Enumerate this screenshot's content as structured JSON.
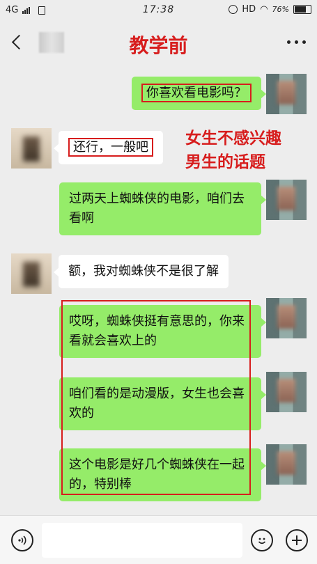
{
  "status_bar": {
    "network": "4G",
    "time": "17:38",
    "hd": "HD",
    "battery_text": "76%",
    "battery_level": 0.76
  },
  "header": {
    "title": "教学前"
  },
  "annotation": {
    "line1": "女生不感兴趣",
    "line2": "男生的话题"
  },
  "messages": [
    {
      "side": "mine",
      "text": "你喜欢看电影吗？",
      "highlighted": true
    },
    {
      "side": "other",
      "text": "还行，一般吧",
      "highlighted": true
    },
    {
      "side": "mine",
      "text": "过两天上蜘蛛侠的电影，咱们去看啊"
    },
    {
      "side": "other",
      "text": "额，我对蜘蛛侠不是很了解"
    },
    {
      "side": "mine",
      "text": "哎呀，蜘蛛侠挺有意思的，你来看就会喜欢上的"
    },
    {
      "side": "mine",
      "text": "咱们看的是动漫版，女生也会喜欢的"
    },
    {
      "side": "mine",
      "text": "这个电影是好几个蜘蛛侠在一起的，特别棒"
    }
  ],
  "colors": {
    "accent_red": "#d71d1d",
    "bubble_mine": "#95ec69",
    "bubble_other": "#ffffff",
    "background": "#ededed"
  },
  "icons": {
    "back": "chevron-left-icon",
    "more": "more-dots-icon",
    "voice": "voice-icon",
    "emoji": "emoji-icon",
    "plus": "plus-icon"
  }
}
